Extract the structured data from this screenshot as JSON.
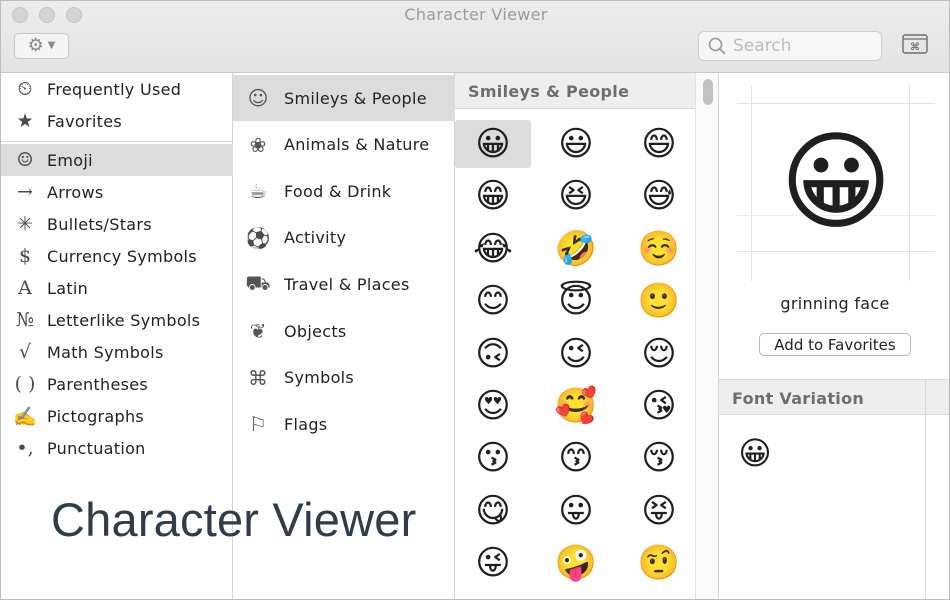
{
  "window": {
    "title": "Character Viewer"
  },
  "toolbar": {
    "action_icon": "gear-icon",
    "search_placeholder": "Search",
    "search_value": ""
  },
  "categories": [
    {
      "label": "Frequently Used",
      "icon": "⏲",
      "selected": false
    },
    {
      "label": "Favorites",
      "icon": "★",
      "selected": false
    },
    {
      "label": "Emoji",
      "icon": "☺",
      "selected": true
    },
    {
      "label": "Arrows",
      "icon": "→",
      "selected": false
    },
    {
      "label": "Bullets/Stars",
      "icon": "✳",
      "selected": false
    },
    {
      "label": "Currency Symbols",
      "icon": "$",
      "selected": false
    },
    {
      "label": "Latin",
      "icon": "A",
      "selected": false
    },
    {
      "label": "Letterlike Symbols",
      "icon": "№",
      "selected": false
    },
    {
      "label": "Math Symbols",
      "icon": "√",
      "selected": false
    },
    {
      "label": "Parentheses",
      "icon": "( )",
      "selected": false
    },
    {
      "label": "Pictographs",
      "icon": "✍",
      "selected": false
    },
    {
      "label": "Punctuation",
      "icon": "•,",
      "selected": false
    }
  ],
  "subcategories": [
    {
      "label": "Smileys & People",
      "icon": "☺",
      "selected": true
    },
    {
      "label": "Animals & Nature",
      "icon": "❀",
      "selected": false
    },
    {
      "label": "Food & Drink",
      "icon": "☕",
      "selected": false
    },
    {
      "label": "Activity",
      "icon": "⚽",
      "selected": false
    },
    {
      "label": "Travel & Places",
      "icon": "⛟",
      "selected": false
    },
    {
      "label": "Objects",
      "icon": "❦",
      "selected": false
    },
    {
      "label": "Symbols",
      "icon": "⌘",
      "selected": false
    },
    {
      "label": "Flags",
      "icon": "⚐",
      "selected": false
    }
  ],
  "emoji_grid": {
    "heading": "Smileys & People",
    "items": [
      "😀",
      "😃",
      "😄",
      "😁",
      "😆",
      "😅",
      "😂",
      "🤣",
      "☺️",
      "😊",
      "😇",
      "🙂",
      "🙃",
      "😉",
      "😌",
      "😍",
      "🥰",
      "😘",
      "😗",
      "😙",
      "😚",
      "😋",
      "😛",
      "😝",
      "😜",
      "🤪",
      "🤨"
    ],
    "selected_index": 0
  },
  "detail": {
    "preview": "😀",
    "name": "grinning face",
    "add_favorites_label": "Add to Favorites",
    "font_variation_heading": "Font Variation",
    "variation": "😀"
  },
  "overlay_caption": "Character Viewer"
}
